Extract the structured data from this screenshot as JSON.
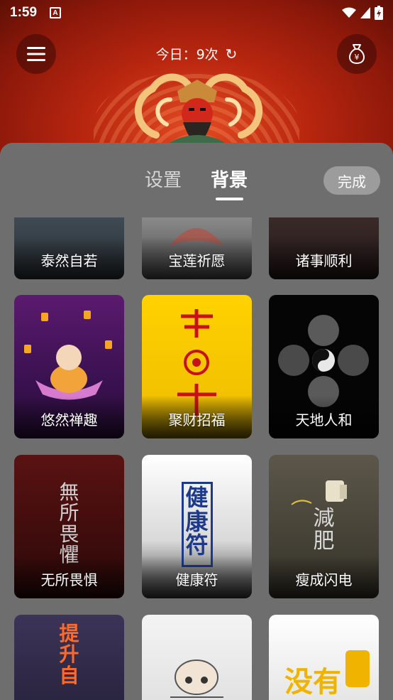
{
  "status_bar": {
    "time": "1:59",
    "notification_icon": "A"
  },
  "header": {
    "count_text": "今日：9次",
    "refresh_glyph": "↻",
    "menu_icon": "menu-icon",
    "money_icon": "money-bag-icon"
  },
  "sheet": {
    "tabs": [
      {
        "label": "设置"
      },
      {
        "label": "背景"
      }
    ],
    "done_label": "完成"
  },
  "backgrounds": [
    {
      "label": "泰然自若"
    },
    {
      "label": "宝莲祈愿"
    },
    {
      "label": "诸事顺利"
    },
    {
      "label": "悠然禅趣"
    },
    {
      "label": "聚财招福"
    },
    {
      "label": "天地人和"
    },
    {
      "label": "无所畏惧",
      "art_text": "無所畏懼"
    },
    {
      "label": "健康符",
      "art_text": "健康符"
    },
    {
      "label": "瘦成闪电",
      "art_text": "減肥"
    },
    {
      "label": "",
      "art_text": "提升自"
    },
    {
      "label": ""
    },
    {
      "label": "",
      "art_text": "没有"
    }
  ],
  "colors": {
    "sheet_bg": "#6e6e6e",
    "hero_red": "#b8260f",
    "active_tab": "#ffffff",
    "inactive_tab": "#d6d6d6"
  }
}
